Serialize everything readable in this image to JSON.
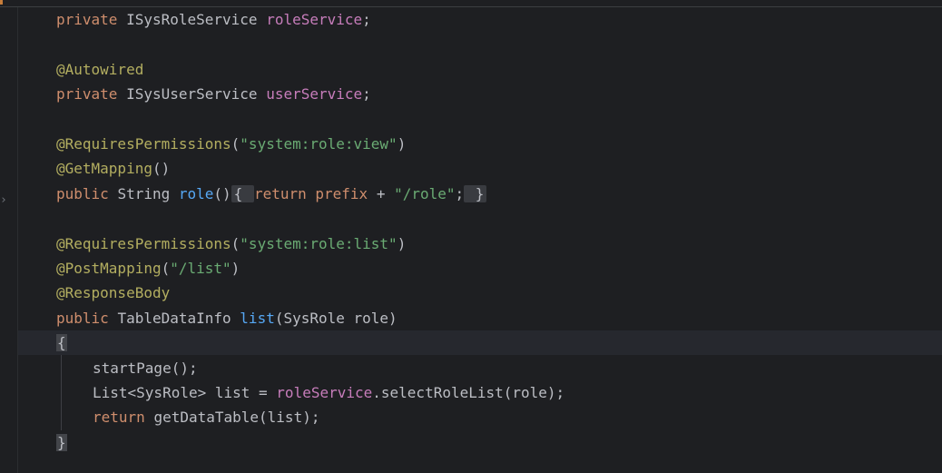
{
  "editor": {
    "lines": [
      {
        "parts": [
          [
            "kw",
            "private "
          ],
          [
            "plain",
            "ISysRoleService "
          ],
          [
            "field",
            "roleService"
          ],
          [
            "plain",
            ";"
          ]
        ]
      },
      {
        "parts": []
      },
      {
        "parts": [
          [
            "ann",
            "@Autowired"
          ]
        ]
      },
      {
        "parts": [
          [
            "kw",
            "private "
          ],
          [
            "plain",
            "ISysUserService "
          ],
          [
            "field",
            "userService"
          ],
          [
            "plain",
            ";"
          ]
        ]
      },
      {
        "parts": []
      },
      {
        "parts": [
          [
            "ann",
            "@RequiresPermissions"
          ],
          [
            "plain",
            "("
          ],
          [
            "str",
            "\"system:role:view\""
          ],
          [
            "plain",
            ")"
          ]
        ]
      },
      {
        "parts": [
          [
            "ann",
            "@GetMapping"
          ],
          [
            "plain",
            "()"
          ]
        ]
      },
      {
        "parts": [
          [
            "kw",
            "public "
          ],
          [
            "plain",
            "String "
          ],
          [
            "fn",
            "role"
          ],
          [
            "plain",
            "()"
          ],
          [
            "fold",
            "{ "
          ],
          [
            "kw",
            "return "
          ],
          [
            "kw",
            "prefix "
          ],
          [
            "plain",
            "+ "
          ],
          [
            "str",
            "\"/role\""
          ],
          [
            "plain",
            ";"
          ],
          [
            "fold",
            " }"
          ]
        ]
      },
      {
        "parts": []
      },
      {
        "parts": [
          [
            "ann",
            "@RequiresPermissions"
          ],
          [
            "plain",
            "("
          ],
          [
            "str",
            "\"system:role:list\""
          ],
          [
            "plain",
            ")"
          ]
        ]
      },
      {
        "parts": [
          [
            "ann",
            "@PostMapping"
          ],
          [
            "plain",
            "("
          ],
          [
            "str",
            "\"/list\""
          ],
          [
            "plain",
            ")"
          ]
        ]
      },
      {
        "parts": [
          [
            "ann",
            "@ResponseBody"
          ]
        ]
      },
      {
        "parts": [
          [
            "kw",
            "public "
          ],
          [
            "plain",
            "TableDataInfo "
          ],
          [
            "fn",
            "list"
          ],
          [
            "plain",
            "(SysRole role)"
          ]
        ]
      },
      {
        "parts": [
          [
            "brace",
            "{"
          ]
        ],
        "caret": true
      },
      {
        "indent": 2,
        "parts": [
          [
            "plain",
            "startPage();"
          ]
        ]
      },
      {
        "indent": 2,
        "parts": [
          [
            "plain",
            "List<SysRole> list = "
          ],
          [
            "field",
            "roleService"
          ],
          [
            "plain",
            ".selectRoleList(role);"
          ]
        ]
      },
      {
        "indent": 2,
        "parts": [
          [
            "kw",
            "return "
          ],
          [
            "plain",
            "getDataTable(list);"
          ]
        ]
      },
      {
        "parts": [
          [
            "brace",
            "}"
          ]
        ]
      }
    ]
  },
  "gutter": {
    "fold_icon": "chevron-right-icon",
    "fold_glyph": "›"
  },
  "colors": {
    "background": "#1e1f22",
    "keyword": "#cf8e6d",
    "annotation": "#b3ae60",
    "string": "#6aab73",
    "field": "#c77dbb",
    "method": "#56a8f5",
    "text": "#bcbec4"
  }
}
